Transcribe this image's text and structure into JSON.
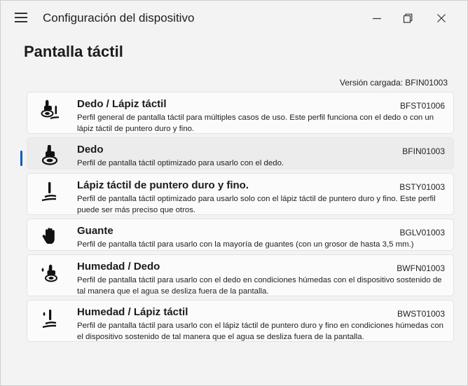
{
  "window": {
    "title": "Configuración del dispositivo",
    "icons": {
      "menu": "hamburger-menu-icon",
      "minimize": "minimize-icon",
      "maximize": "maximize-icon",
      "close": "close-icon"
    }
  },
  "page": {
    "heading": "Pantalla táctil",
    "loaded_version": "Versión cargada: BFIN01003"
  },
  "profiles": [
    {
      "name": "Dedo / Lápiz táctil",
      "code": "BFST01006",
      "description": "Perfil general de pantalla táctil para múltiples casos de uso. Este perfil funciona con el dedo o con un lápiz táctil de puntero duro y fino.",
      "icon": "finger-and-stylus-icon",
      "selected": false
    },
    {
      "name": "Dedo",
      "code": "BFIN01003",
      "description": "Perfil de pantalla táctil optimizado para usarlo con el dedo.",
      "icon": "finger-touch-icon",
      "selected": true
    },
    {
      "name": "Lápiz táctil de puntero duro y fino.",
      "code": "BSTY01003",
      "description": "Perfil de pantalla táctil optimizado para usarlo solo con el lápiz táctil de puntero duro y fino. Este perfil puede ser más preciso que otros.",
      "icon": "stylus-icon",
      "selected": false
    },
    {
      "name": "Guante",
      "code": "BGLV01003",
      "description": "Perfil de pantalla táctil para usarlo con la mayoría de guantes (con un grosor de hasta 3,5 mm.)",
      "icon": "glove-icon",
      "selected": false
    },
    {
      "name": "Humedad / Dedo",
      "code": "BWFN01003",
      "description": "Perfil de pantalla táctil para usarlo con el dedo en condiciones húmedas con el dispositivo sostenido de tal manera que el agua se desliza fuera de la pantalla.",
      "icon": "wet-finger-icon",
      "selected": false
    },
    {
      "name": "Humedad / Lápiz táctil",
      "code": "BWST01003",
      "description": "Perfil de pantalla táctil para usarlo con el lápiz táctil de puntero duro y fino en condiciones húmedas con el dispositivo sostenido de tal manera que el agua se desliza fuera de la pantalla.",
      "icon": "wet-stylus-icon",
      "selected": false
    }
  ]
}
